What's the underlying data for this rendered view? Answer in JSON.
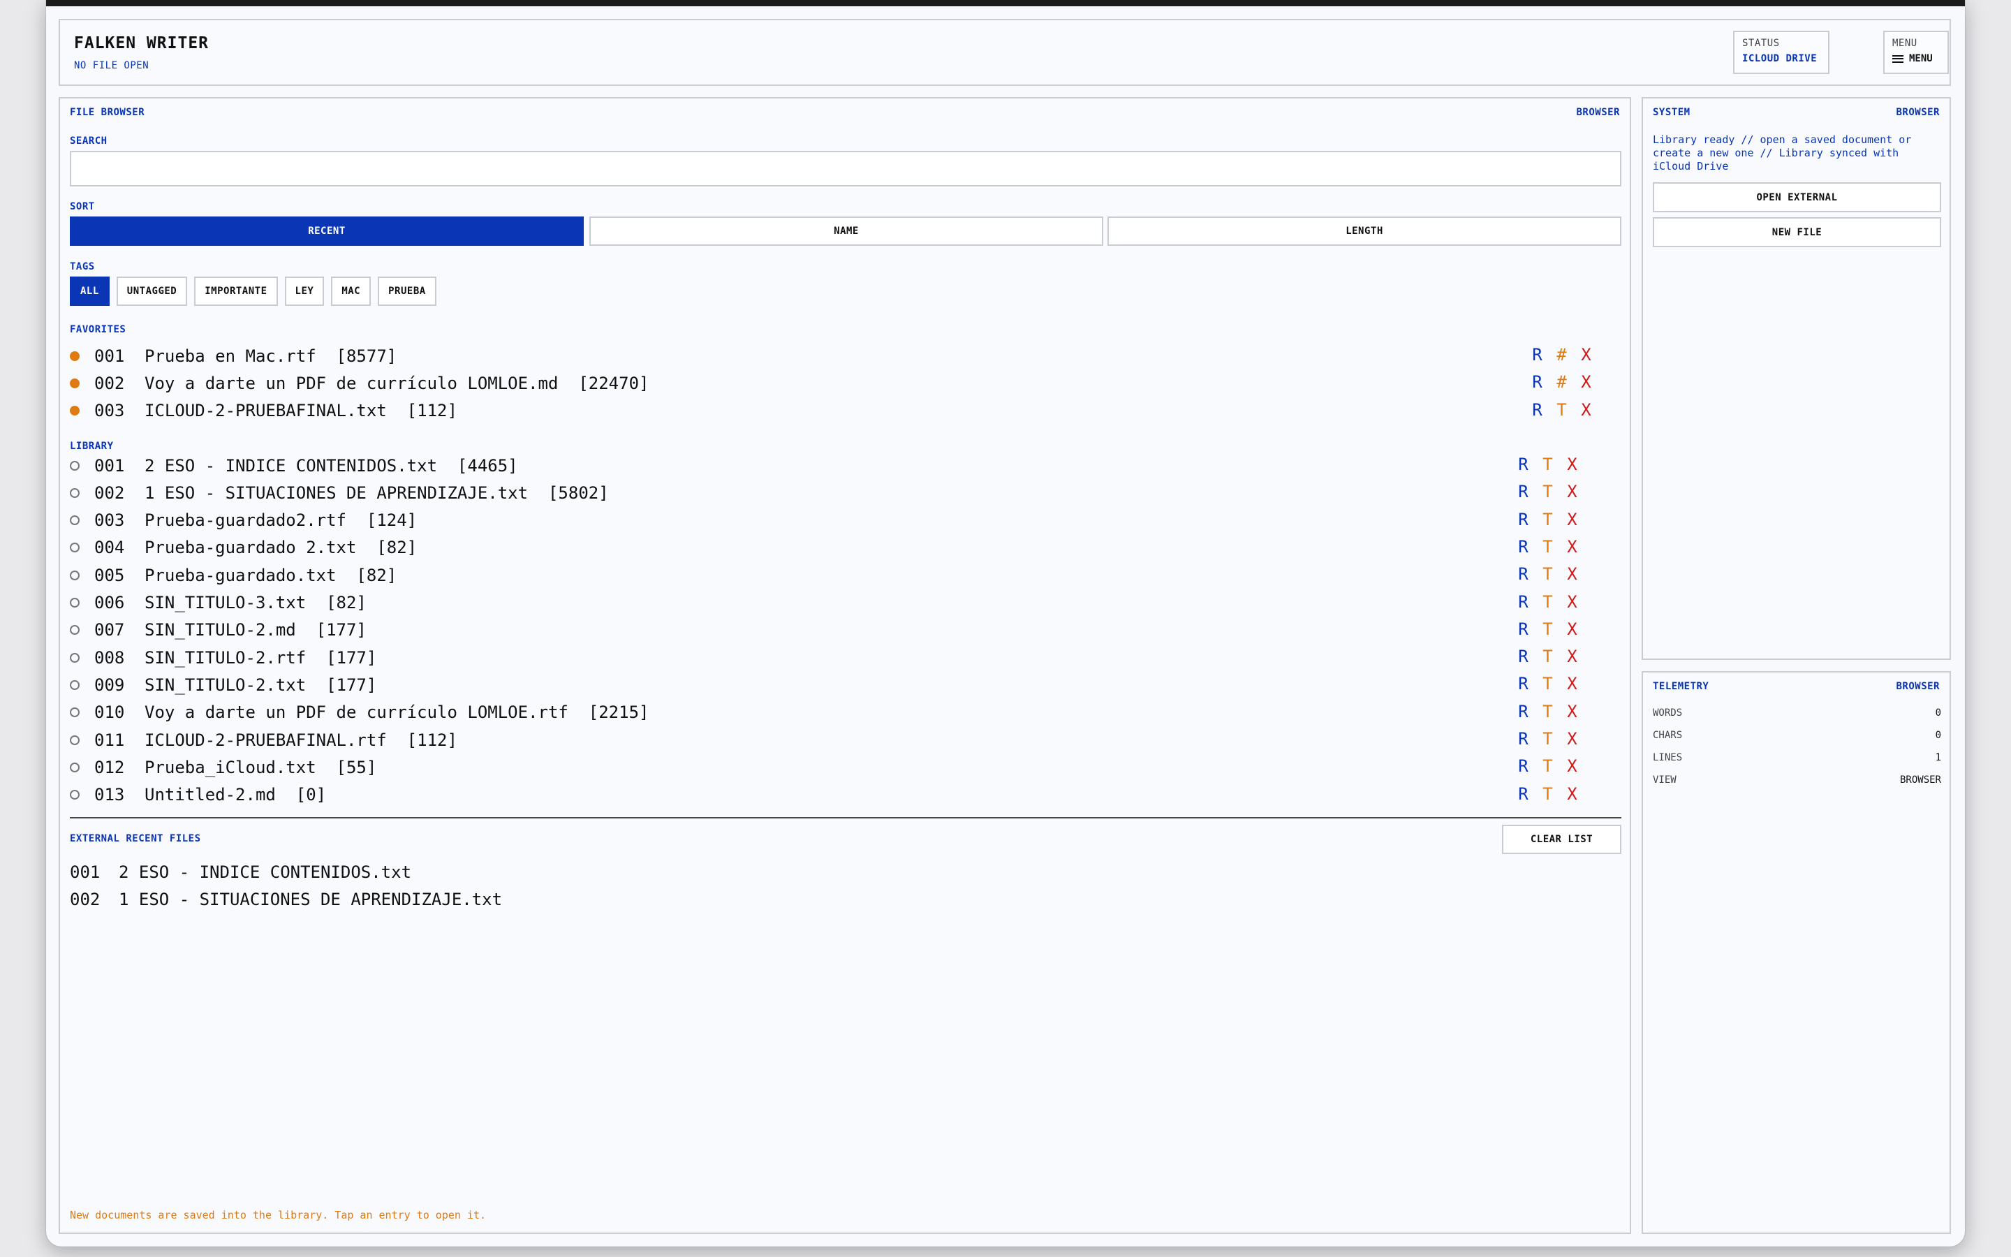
{
  "header": {
    "app_title": "FALKEN WRITER",
    "file_status": "NO FILE OPEN",
    "status_caption": "STATUS",
    "status_value": "ICLOUD DRIVE",
    "menu_caption": "MENU",
    "menu_label": "MENU"
  },
  "browser": {
    "title": "FILE BROWSER",
    "mode": "BROWSER",
    "search_label": "SEARCH",
    "search_value": "",
    "search_placeholder": "",
    "sort_label": "SORT",
    "sort_options": [
      "RECENT",
      "NAME",
      "LENGTH"
    ],
    "sort_active": "RECENT",
    "tags_label": "TAGS",
    "tags": [
      "ALL",
      "UNTAGGED",
      "IMPORTANTE",
      "LEY",
      "MAC",
      "PRUEBA"
    ],
    "tag_active": "ALL",
    "favorites_label": "FAVORITES",
    "favorites": [
      {
        "num": "001",
        "name": "Prueba en Mac.rtf",
        "length": "[8577]",
        "actions": [
          "R",
          "#",
          "X"
        ]
      },
      {
        "num": "002",
        "name": "Voy a darte un PDF de currículo LOMLOE.md",
        "length": "[22470]",
        "actions": [
          "R",
          "#",
          "X"
        ]
      },
      {
        "num": "003",
        "name": "ICLOUD-2-PRUEBAFINAL.txt",
        "length": "[112]",
        "actions": [
          "R",
          "T",
          "X"
        ]
      }
    ],
    "library_label": "LIBRARY",
    "library": [
      {
        "num": "001",
        "name": "2 ESO - INDICE CONTENIDOS.txt",
        "length": "[4465]"
      },
      {
        "num": "002",
        "name": "1 ESO - SITUACIONES DE APRENDIZAJE.txt",
        "length": "[5802]"
      },
      {
        "num": "003",
        "name": "Prueba-guardado2.rtf",
        "length": "[124]"
      },
      {
        "num": "004",
        "name": "Prueba-guardado 2.txt",
        "length": "[82]"
      },
      {
        "num": "005",
        "name": "Prueba-guardado.txt",
        "length": "[82]"
      },
      {
        "num": "006",
        "name": "SIN_TITULO-3.txt",
        "length": "[82]"
      },
      {
        "num": "007",
        "name": "SIN_TITULO-2.md",
        "length": "[177]"
      },
      {
        "num": "008",
        "name": "SIN_TITULO-2.rtf",
        "length": "[177]"
      },
      {
        "num": "009",
        "name": "SIN_TITULO-2.txt",
        "length": "[177]"
      },
      {
        "num": "010",
        "name": "Voy a darte un PDF de currículo LOMLOE.rtf",
        "length": "[2215]"
      },
      {
        "num": "011",
        "name": "ICLOUD-2-PRUEBAFINAL.rtf",
        "length": "[112]"
      },
      {
        "num": "012",
        "name": "Prueba_iCloud.txt",
        "length": "[55]"
      },
      {
        "num": "013",
        "name": "Untitled-2.md",
        "length": "[0]"
      }
    ],
    "library_actions": [
      "R",
      "T",
      "X"
    ],
    "external_label": "EXTERNAL RECENT FILES",
    "clear_label": "CLEAR LIST",
    "external": [
      {
        "num": "001",
        "name": "2 ESO - INDICE CONTENIDOS.txt"
      },
      {
        "num": "002",
        "name": "1 ESO - SITUACIONES DE APRENDIZAJE.txt"
      }
    ],
    "footer_note": "New documents are saved into the library. Tap an entry to open it."
  },
  "system": {
    "title": "SYSTEM",
    "mode": "BROWSER",
    "message": "Library ready // open a saved document or create a new one // Library synced with iCloud Drive",
    "open_external_label": "OPEN EXTERNAL",
    "new_file_label": "NEW FILE"
  },
  "telemetry": {
    "title": "TELEMETRY",
    "mode": "BROWSER",
    "rows": [
      {
        "key": "WORDS",
        "value": "0"
      },
      {
        "key": "CHARS",
        "value": "0"
      },
      {
        "key": "LINES",
        "value": "1"
      },
      {
        "key": "VIEW",
        "value": "BROWSER"
      }
    ]
  },
  "colors": {
    "accent": "#0a36b5",
    "orange": "#e07b12",
    "delete": "#d11a1a",
    "panel_border": "#c9ccd3"
  }
}
